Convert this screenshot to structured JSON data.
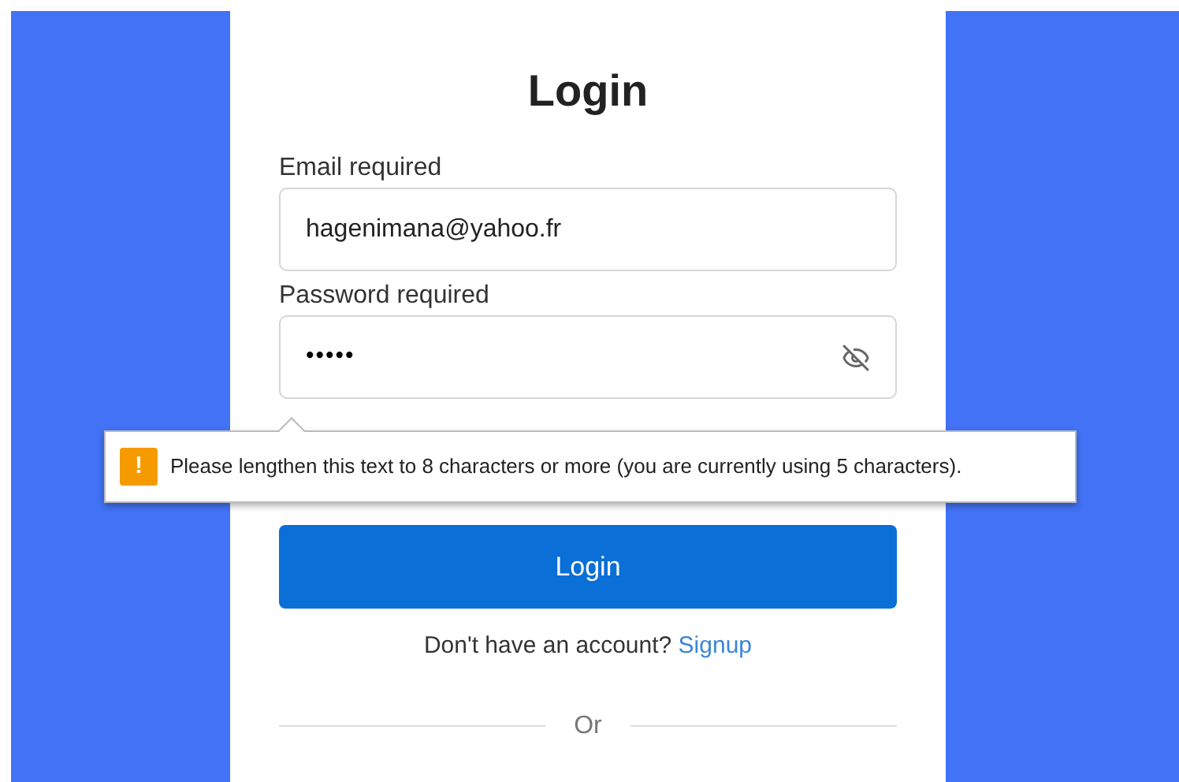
{
  "title": "Login",
  "fields": [
    {
      "label": "Email required",
      "value": "hagenimana@yahoo.fr",
      "kind": "text"
    },
    {
      "label": "Password required",
      "value": "•••••",
      "kind": "password"
    }
  ],
  "tooltip": {
    "icon": "!",
    "text": "Please lengthen this text to 8 characters or more (you are currently using 5 characters)."
  },
  "login_button": "Login",
  "signup_prompt": {
    "text": "Don't have an account?",
    "link": "Signup"
  },
  "divider": "Or"
}
